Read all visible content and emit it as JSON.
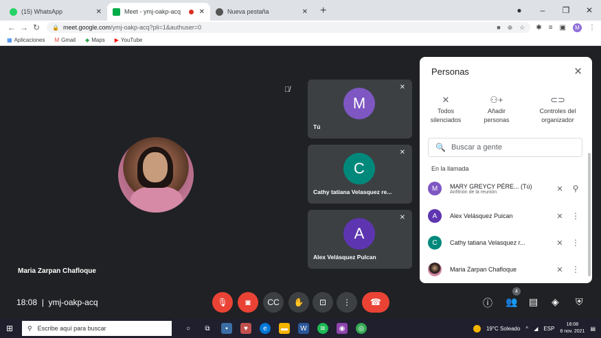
{
  "tabs": [
    {
      "title": "(15) WhatsApp",
      "color": "#25d366"
    },
    {
      "title": "Meet - ymj-oakp-acq",
      "color": "#00ac47",
      "recording": true
    },
    {
      "title": "Nueva pestaña",
      "color": "#444"
    }
  ],
  "address": {
    "host": "meet.google.com",
    "path": "/ymj-oakp-acq?pli=1&authuser=0",
    "profile": "M"
  },
  "bookmarks": [
    "Aplicaciones",
    "Gmail",
    "Maps",
    "YouTube"
  ],
  "main": {
    "name": "Maria Zarpan Chafloque"
  },
  "tiles": [
    {
      "initial": "M",
      "name": "Tú",
      "color": "#7e57c2"
    },
    {
      "initial": "C",
      "name": "Cathy tatiana Velasquez re...",
      "color": "#00897b"
    },
    {
      "initial": "A",
      "name": "Alex Velásquez Pulcan",
      "color": "#5e35b1"
    }
  ],
  "panel": {
    "title": "Personas",
    "actions": [
      {
        "label1": "Todos",
        "label2": "silenciados"
      },
      {
        "label1": "Añadir",
        "label2": "personas"
      },
      {
        "label1": "Controles del",
        "label2": "organizador"
      }
    ],
    "search_placeholder": "Buscar a gente",
    "section": "En la llamada",
    "people": [
      {
        "initial": "M",
        "name": "MARY GREYCY PÉRE...  (Tú)",
        "sub": "Anfitrión de la reunión",
        "color": "#7e57c2"
      },
      {
        "initial": "A",
        "name": "Alex Velásquez Puican",
        "sub": "",
        "color": "#5e35b1"
      },
      {
        "initial": "C",
        "name": "Cathy tatiana Velasquez r...",
        "sub": "",
        "color": "#00897b"
      },
      {
        "initial": "",
        "name": "Maria Zarpan Chafloque",
        "sub": "",
        "color": "#b46b88"
      }
    ]
  },
  "bottom": {
    "time": "18:08",
    "code": "ymj-oakp-acq",
    "participants": "4"
  },
  "taskbar": {
    "search": "Escribe aquí para buscar",
    "weather": "19°C Soleado",
    "lang": "ESP",
    "time": "18:08",
    "date": "8 nov. 2021"
  }
}
